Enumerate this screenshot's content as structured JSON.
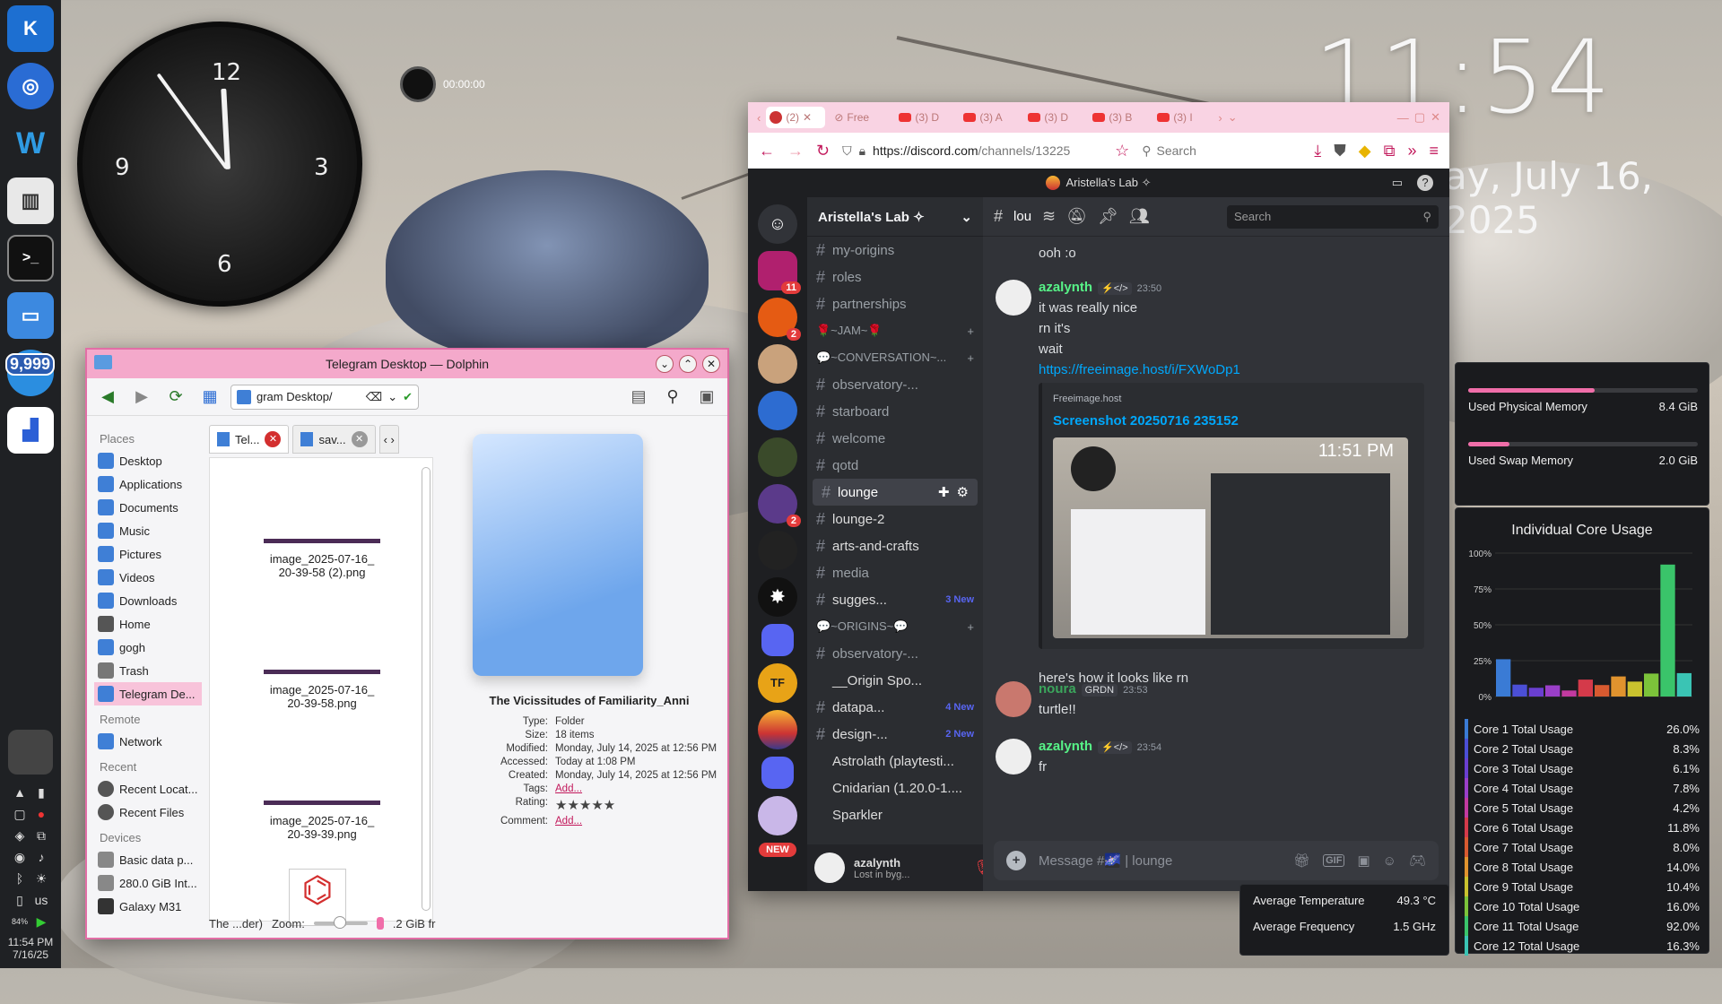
{
  "clock": {
    "time": "11:54 PM",
    "date": "Wednesday, July 16, 2025",
    "date_visible": "ay, July 16, 2025",
    "numbers": [
      "12",
      "3",
      "6",
      "9"
    ],
    "stopwatch": "00:00:00"
  },
  "panel": {
    "badge": "9,999",
    "tray_lang": "us",
    "time": "11:54 PM",
    "date": "7/16/25",
    "battery": "84%"
  },
  "dolphin": {
    "title": "Telegram Desktop — Dolphin",
    "path": "gram Desktop/",
    "places_header": "Places",
    "remote_header": "Remote",
    "recent_header": "Recent",
    "devices_header": "Devices",
    "places": [
      "Desktop",
      "Applications",
      "Documents",
      "Music",
      "Pictures",
      "Videos",
      "Downloads",
      "Home",
      "gogh",
      "Trash",
      "Telegram De..."
    ],
    "remote": [
      "Network"
    ],
    "recent": [
      "Recent Locat...",
      "Recent Files"
    ],
    "devices": [
      "Basic data p...",
      "280.0 GiB Int...",
      "Galaxy M31"
    ],
    "tabs": [
      "Tel...",
      "sav..."
    ],
    "files": [
      {
        "line1": "image_2025-07-16_",
        "line2": "20-39-58 (2).png"
      },
      {
        "line1": "image_2025-07-16_",
        "line2": "20-39-58.png"
      },
      {
        "line1": "image_2025-07-16_",
        "line2": "20-39-39.png"
      }
    ],
    "info": {
      "name": "The Vicissitudes of Familiarity_Anni",
      "rows": [
        {
          "k": "Type:",
          "v": "Folder"
        },
        {
          "k": "Size:",
          "v": "18 items"
        },
        {
          "k": "Modified:",
          "v": "Monday, July 14, 2025 at 12:56 PM"
        },
        {
          "k": "Accessed:",
          "v": "Today at 1:08 PM"
        },
        {
          "k": "Created:",
          "v": "Monday, July 14, 2025 at 12:56 PM"
        },
        {
          "k": "Tags:",
          "v": "Add..."
        },
        {
          "k": "Rating:",
          "v": "★★★★★"
        },
        {
          "k": "Comment:",
          "v": "Add..."
        }
      ]
    },
    "status": {
      "text": "The ...der)",
      "zoom_label": "Zoom:",
      "free": ".2 GiB fr"
    }
  },
  "browser": {
    "url_host": "https://discord.com",
    "url_path": "/channels/13225",
    "search": "Search",
    "tab_labels": [
      "(2)",
      "Free",
      "(3) D",
      "(3) A",
      "(3) D",
      "(3) B",
      "(3) I"
    ]
  },
  "discord": {
    "top_title": "Aristella's Lab ✧",
    "server_name": "Aristella's Lab ✧",
    "server_badges": [
      "11",
      "2",
      "2"
    ],
    "new_label": "NEW",
    "categories": [
      "🌹~JAM~🌹",
      "💬~CONVERSATION~...",
      "💬~ORIGINS~💬"
    ],
    "channels_a": [
      {
        "n": "my-origins"
      },
      {
        "n": "roles"
      },
      {
        "n": "partnerships"
      }
    ],
    "channels_b": [
      {
        "n": "observatory-..."
      },
      {
        "n": "starboard"
      },
      {
        "n": "welcome"
      },
      {
        "n": "qotd"
      },
      {
        "n": "lounge"
      },
      {
        "n": "lounge-2"
      },
      {
        "n": "arts-and-crafts"
      },
      {
        "n": "media"
      },
      {
        "n": "sugges...",
        "badge": "3 New"
      }
    ],
    "channels_c": [
      {
        "n": "observatory-..."
      },
      {
        "n": "__Origin Spo..."
      },
      {
        "n": "datapa...",
        "badge": "4 New"
      },
      {
        "n": "design-...",
        "badge": "2 New"
      },
      {
        "n": "Astrolath (playtesti..."
      },
      {
        "n": "Cnidarian (1.20.0-1...."
      },
      {
        "n": "Sparkler"
      }
    ],
    "chat_channel": "lou",
    "search": "Search",
    "messages": [
      {
        "text": "ooh :o"
      },
      {
        "user": "azalynth",
        "tag": "⚡</>",
        "time": "23:50",
        "lines": [
          "it was really nice",
          "rn it's",
          "wait"
        ],
        "link": "https://freeimage.host/i/FXWoDp1"
      },
      {
        "embed_site": "Freeimage.host",
        "embed_title": "Screenshot 20250716 235152",
        "embed_img_time": "11:51 PM"
      },
      {
        "text": "here's how it looks like rn"
      },
      {
        "user": "noura",
        "tag": "GRDN",
        "time": "23:53",
        "lines": [
          "turtle!!"
        ]
      },
      {
        "user": "azalynth",
        "tag": "⚡</>",
        "time": "23:54",
        "lines": [
          "fr"
        ]
      }
    ],
    "input_placeholder": "Message #🌌 | lounge",
    "user": {
      "name": "azalynth",
      "status": "Lost in byg..."
    }
  },
  "monitor": {
    "memory": [
      {
        "label": "Used Physical Memory",
        "value": "8.4 GiB",
        "fill": 0.55
      },
      {
        "label": "Used Swap Memory",
        "value": "2.0 GiB",
        "fill": 0.18
      }
    ],
    "temp": [
      {
        "label": "Average Temperature",
        "value": "49.3 °C"
      },
      {
        "label": "Average Frequency",
        "value": "1.5 GHz"
      }
    ]
  },
  "chart_data": {
    "type": "bar",
    "title": "Individual Core Usage",
    "yticks": [
      "100%",
      "75%",
      "50%",
      "25%",
      "0%"
    ],
    "ylim": [
      0,
      100
    ],
    "categories": [
      "Core 1 Total Usage",
      "Core 2 Total Usage",
      "Core 3 Total Usage",
      "Core 4 Total Usage",
      "Core 5 Total Usage",
      "Core 6 Total Usage",
      "Core 7 Total Usage",
      "Core 8 Total Usage",
      "Core 9 Total Usage",
      "Core 10 Total Usage",
      "Core 11 Total Usage",
      "Core 12 Total Usage"
    ],
    "values": [
      26.0,
      8.3,
      6.1,
      7.8,
      4.2,
      11.8,
      8.0,
      14.0,
      10.4,
      16.0,
      92.0,
      16.3
    ],
    "value_labels": [
      "26.0%",
      "8.3%",
      "6.1%",
      "7.8%",
      "4.2%",
      "11.8%",
      "8.0%",
      "14.0%",
      "10.4%",
      "16.0%",
      "92.0%",
      "16.3%"
    ],
    "colors": [
      "#3a7bd5",
      "#4b4fd6",
      "#6a3fd0",
      "#9a3fc8",
      "#c23aa0",
      "#d43a4a",
      "#d85a30",
      "#e0932e",
      "#c9c22e",
      "#7cc33a",
      "#3ac46a",
      "#3ac4b4"
    ]
  }
}
